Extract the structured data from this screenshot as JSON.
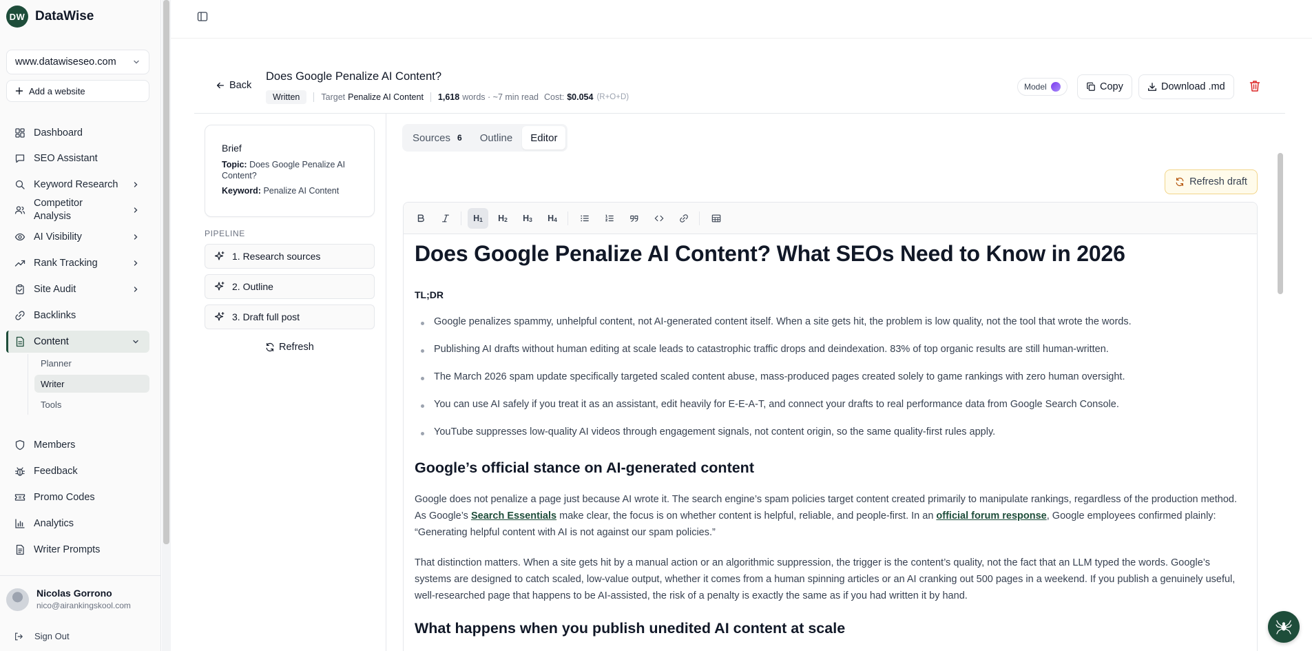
{
  "brand": {
    "initials": "DW",
    "name": "DataWise"
  },
  "site_selector": {
    "value": "www.datawiseseo.com"
  },
  "add_website": {
    "label": "Add a website"
  },
  "nav": {
    "dashboard": "Dashboard",
    "seo_assistant": "SEO Assistant",
    "keyword_research": "Keyword Research",
    "competitor_analysis_1": "Competitor",
    "competitor_analysis_2": "Analysis",
    "ai_visibility": "AI Visibility",
    "rank_tracking": "Rank Tracking",
    "site_audit": "Site Audit",
    "backlinks": "Backlinks",
    "content": "Content",
    "members": "Members",
    "feedback": "Feedback",
    "promo_codes": "Promo Codes",
    "analytics": "Analytics",
    "writer_prompts": "Writer Prompts"
  },
  "content_sub": {
    "planner": "Planner",
    "writer": "Writer",
    "tools": "Tools"
  },
  "user": {
    "name": "Nicolas Gorrono",
    "email": "nico@airankingskool.com",
    "sign_out": "Sign Out"
  },
  "header": {
    "back": "Back",
    "title": "Does Google Penalize AI Content?",
    "status": "Written",
    "target_label": "Target",
    "target_value": "Penalize AI Content",
    "word_count": "1,618",
    "words_label": "words · ~7 min read",
    "cost_label": "Cost:",
    "cost_value": "$0.054",
    "cost_note": "(R+O+D)",
    "model": "Model",
    "copy": "Copy",
    "download": "Download .md"
  },
  "brief": {
    "title": "Brief",
    "topic_label": "Topic:",
    "topic_value": "Does Google Penalize AI Content?",
    "keyword_label": "Keyword:",
    "keyword_value": "Penalize AI Content"
  },
  "pipeline": {
    "label": "PIPELINE",
    "steps": [
      "1. Research sources",
      "2. Outline",
      "3. Draft full post"
    ],
    "refresh": "Refresh"
  },
  "tabs": {
    "sources": "Sources",
    "sources_count": "6",
    "outline": "Outline",
    "editor": "Editor"
  },
  "refresh_draft": "Refresh draft",
  "editor": {
    "h1": "Does Google Penalize AI Content? What SEOs Need to Know in 2026",
    "tldr": "TL;DR",
    "bullets": [
      "Google penalizes spammy, unhelpful content, not AI-generated content itself. When a site gets hit, the problem is low quality, not the tool that wrote the words.",
      "Publishing AI drafts without human editing at scale leads to catastrophic traffic drops and deindexation. 83% of top organic results are still human-written.",
      "The March 2026 spam update specifically targeted scaled content abuse, mass-produced pages created solely to game rankings with zero human oversight.",
      "You can use AI safely if you treat it as an assistant, edit heavily for E-E-A-T, and connect your drafts to real performance data from Google Search Console.",
      "YouTube suppresses low-quality AI videos through engagement signals, not content origin, so the same quality-first rules apply."
    ],
    "h2_1": "Google’s official stance on AI-generated content",
    "p1_a": "Google does not penalize a page just because AI wrote it. The search engine’s spam policies target content created primarily to manipulate rankings, regardless of the production method. As Google’s ",
    "p1_link1": "Search Essentials",
    "p1_b": " make clear, the focus is on whether content is helpful, reliable, and people-first. In an ",
    "p1_link2": "official forum response",
    "p1_c": ", Google employees confirmed plainly: “Generating helpful content with AI is not against our spam policies.”",
    "p2": "That distinction matters. When a site gets hit by a manual action or an algorithmic suppression, the trigger is the content’s quality, not the fact that an LLM typed the words. Google’s systems are designed to catch scaled, low-value output, whether it comes from a human spinning articles or an AI cranking out 500 pages in a weekend. If you publish a genuinely useful, well-researched page that happens to be AI-assisted, the risk of a penalty is exactly the same as if you had written it by hand.",
    "h2_2": "What happens when you publish unedited AI content at scale"
  }
}
